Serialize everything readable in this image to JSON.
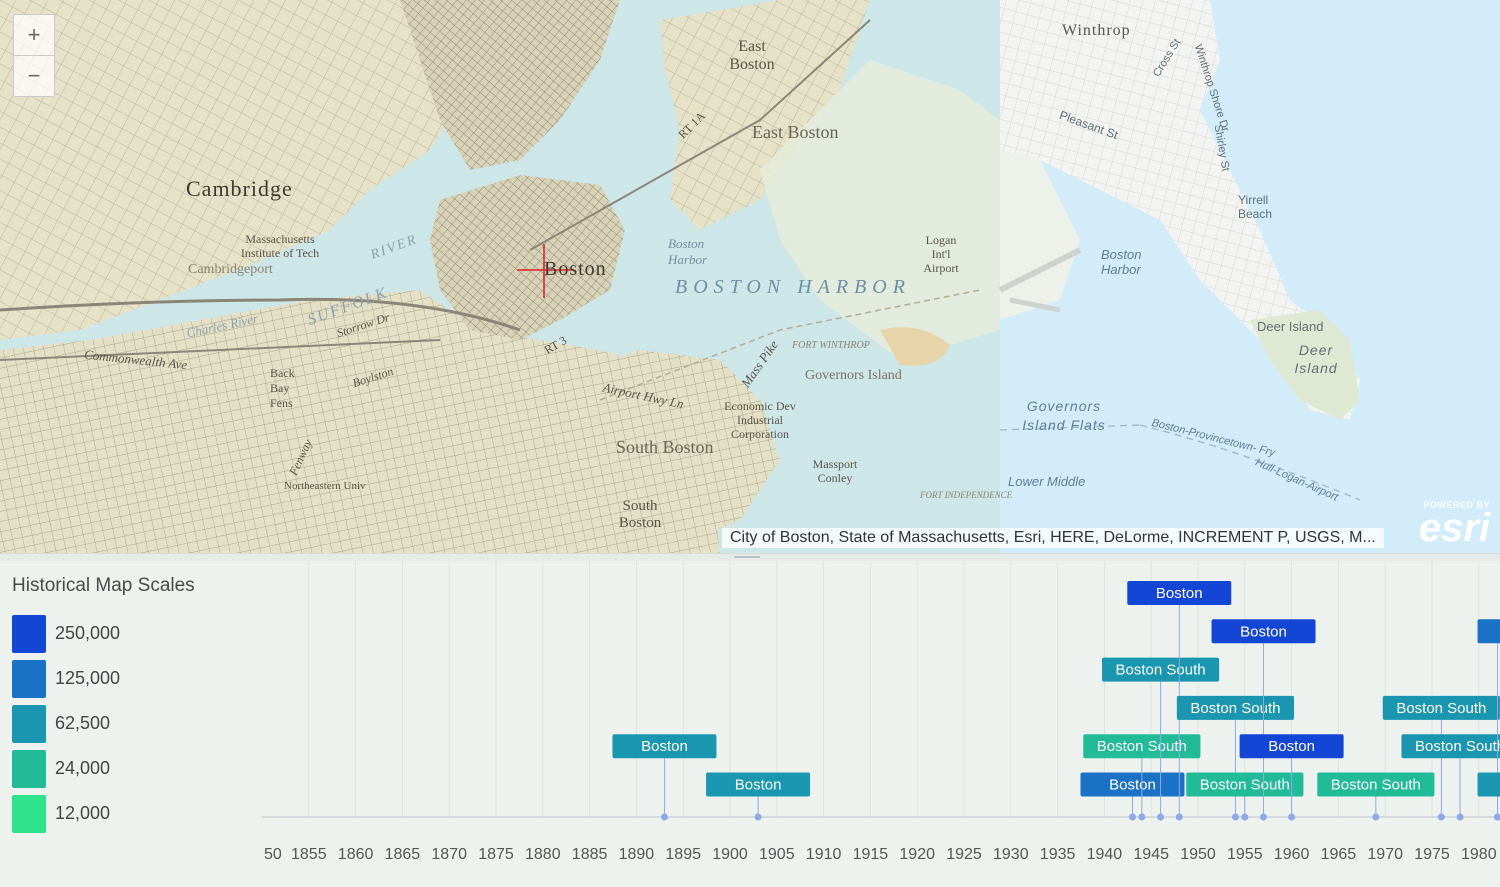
{
  "map": {
    "zoom_in_label": "+",
    "zoom_out_label": "−",
    "attribution": "City of Boston, State of Massachusetts, Esri, HERE, DeLorme, INCREMENT P, USGS, M...",
    "logo_powered": "POWERED BY",
    "logo_word": "esri",
    "labels": {
      "cambridge": "Cambridge",
      "boston": "Boston",
      "east_boston": "East Boston",
      "east_boston_2": "East Boston",
      "boston_harbor": "BOSTON HARBOR",
      "boston_harbor_small": "Boston Harbor",
      "south_boston": "South Boston",
      "south_boston_2": "South Boston",
      "governors_island": "Governors Island",
      "winthrop": "Winthrop",
      "boston_harbor_modern": "Boston Harbor",
      "deer_island": "Deer Island",
      "deer_island_2": "Deer Island",
      "governors_island_flats": "Governors Island Flats",
      "lower_middle": "Lower Middle",
      "logan_airport": "Logan Int'l Airport",
      "yirrell_beach": "Yirrell Beach",
      "massport_conley": "Massport Conley",
      "economic_dev": "Economic Dev Industrial Corporation",
      "fort_winthrop": "FORT WINTHROP",
      "fort_independence": "FORT INDEPENDENCE",
      "ferry": "Boston-Provincetown- Fry",
      "hull_ferry": "Hull-Logan-Airport",
      "mit": "Massachusetts Institute of Tech",
      "suffolk": "SUFFOLK",
      "charles_river": "Charles River",
      "cambridgeport": "Cambridgeport",
      "back_bay": "Back Bay Fens",
      "commonwealth": "Commonwealth Ave",
      "mass_pike": "Mass Pike",
      "pleasant_st": "Pleasant St",
      "winthrop_shore": "Winthrop Shore Dr",
      "shirley_st": "Shirley St",
      "cross_st": "Cross St",
      "airport_hwy": "Airport Hwy Ln",
      "northeastern": "Northeastern Univ",
      "storrow": "Storrow Dr",
      "boylston": "Boylston",
      "fenway": "Fenway",
      "rt_1a": "RT 1A",
      "rt_3": "RT 3",
      "river": "RIVER"
    }
  },
  "legend": {
    "title": "Historical Map Scales",
    "items": [
      {
        "label": "250,000",
        "color": "#1446d6"
      },
      {
        "label": "125,000",
        "color": "#1a72c6"
      },
      {
        "label": "62,500",
        "color": "#1a96b0"
      },
      {
        "label": "24,000",
        "color": "#22bb98"
      },
      {
        "label": "12,000",
        "color": "#2fe38a"
      }
    ]
  },
  "chart_data": {
    "type": "scatter",
    "title": "",
    "xlabel": "",
    "ylabel": "",
    "x_ticks": [
      "50",
      "1855",
      "1860",
      "1865",
      "1870",
      "1875",
      "1880",
      "1885",
      "1890",
      "1895",
      "1900",
      "1905",
      "1910",
      "1915",
      "1920",
      "1925",
      "1930",
      "1935",
      "1940",
      "1945",
      "1950",
      "1955",
      "1960",
      "1965",
      "1970",
      "1975",
      "1980"
    ],
    "xlim": [
      1850,
      1980
    ],
    "grid": true,
    "markers": [
      {
        "label": "Boston",
        "year": 1893,
        "scale": "62,500",
        "row": 1
      },
      {
        "label": "Boston",
        "year": 1903,
        "scale": "62,500",
        "row": 0
      },
      {
        "label": "Boston",
        "year": 1943,
        "scale": "125,000",
        "row": 0
      },
      {
        "label": "Boston South",
        "year": 1944,
        "scale": "24,000",
        "row": 1
      },
      {
        "label": "Boston South",
        "year": 1946,
        "scale": "62,500",
        "row": 3
      },
      {
        "label": "Boston",
        "year": 1948,
        "scale": "250,000",
        "row": 5
      },
      {
        "label": "Boston South",
        "year": 1954,
        "scale": "62,500",
        "row": 2
      },
      {
        "label": "Boston South",
        "year": 1955,
        "scale": "24,000",
        "row": 0
      },
      {
        "label": "Boston",
        "year": 1957,
        "scale": "250,000",
        "row": 4
      },
      {
        "label": "Boston",
        "year": 1960,
        "scale": "250,000",
        "row": 1
      },
      {
        "label": "Boston South",
        "year": 1969,
        "scale": "24,000",
        "row": 0
      },
      {
        "label": "Boston South",
        "year": 1976,
        "scale": "62,500",
        "row": 2
      },
      {
        "label": "Boston South",
        "year": 1978,
        "scale": "62,500",
        "row": 1
      },
      {
        "label": "",
        "year": 1982,
        "scale": "125,000",
        "row": 4
      },
      {
        "label": "",
        "year": 1982,
        "scale": "62,500",
        "row": 0
      }
    ]
  }
}
